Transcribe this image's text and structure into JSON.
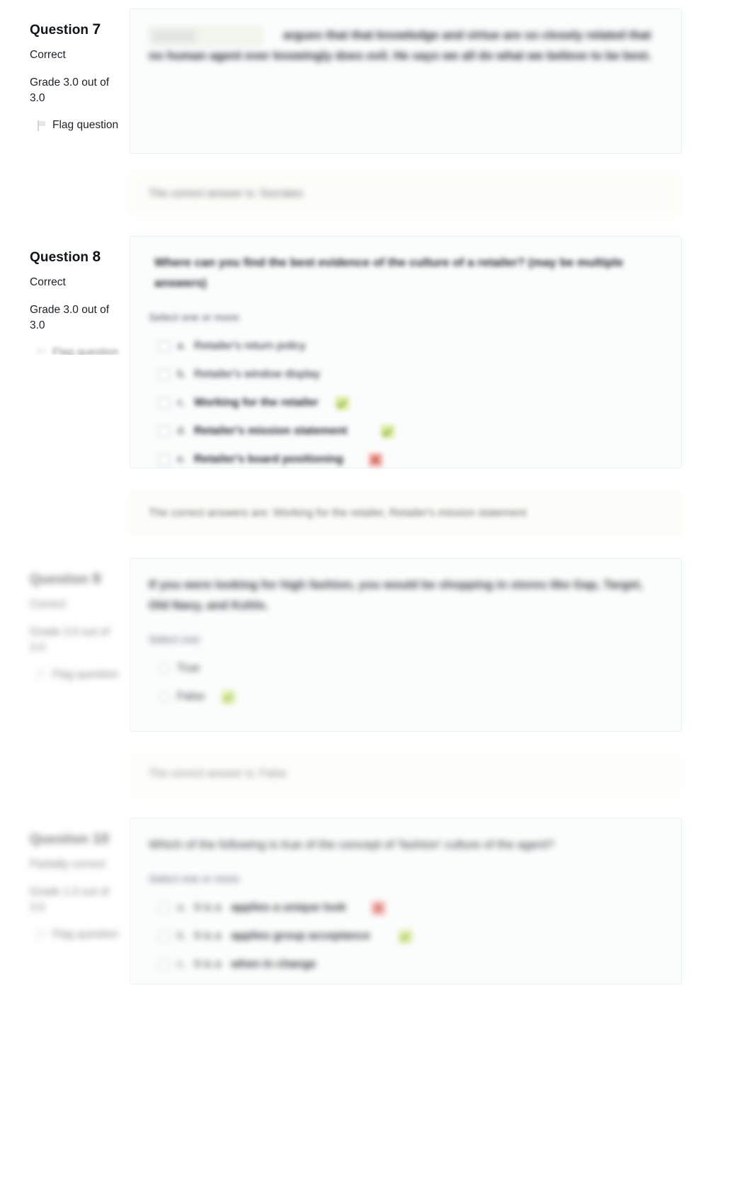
{
  "page": {
    "type": "quiz-review",
    "accent_correct": "#d9ec9a",
    "accent_wrong": "#f3a9a3",
    "panel_bg": "#fbfdfd",
    "feedback_bg": "#fcfdf6"
  },
  "questions": [
    {
      "id": "q7",
      "number_label": "Question",
      "number": "7",
      "state": "Correct",
      "grade": "Grade 3.0 out of 3.0",
      "flag_label": "Flag question",
      "type": "drag-and-drop-into-text",
      "text": "argues that that knowledge and virtue are so closely related that no human agent ever knowingly does evil. He says we all do what we believe to be best.",
      "dropzone_value": "Socrates",
      "options": [],
      "feedback_label": "The correct answer is:",
      "feedback_value": "Socrates"
    },
    {
      "id": "q8",
      "number_label": "Question",
      "number": "8",
      "state": "Correct",
      "grade": "Grade 3.0 out of 3.0",
      "flag_label": "Flag question",
      "type": "multiple-choice-multi",
      "text": "Where can you find the best evidence of the culture of a retailer? (may be multiple answers)",
      "prompt": "Select one or more:",
      "options": [
        {
          "letter": "a.",
          "text": "Retailer's return policy",
          "mark": ""
        },
        {
          "letter": "b.",
          "text": "Retailer's window display",
          "mark": ""
        },
        {
          "letter": "c.",
          "text": "Working for the retailer",
          "mark": "correct"
        },
        {
          "letter": "d.",
          "text": "Retailer's mission statement",
          "mark": "correct"
        },
        {
          "letter": "e.",
          "text": "Retailer's board positioning",
          "mark": "wrong"
        }
      ],
      "feedback_label": "The correct answers are:",
      "feedback_value": "Working for the retailer, Retailer's mission statement"
    },
    {
      "id": "q9",
      "number_label": "Question",
      "number": "9",
      "state": "Correct",
      "grade": "Grade 3.0 out of 3.0",
      "flag_label": "Flag question",
      "type": "true-false",
      "text": "If you were looking for high fashion, you would be shopping in stores like Gap, Target, Old Navy, and Kohls.",
      "prompt": "Select one:",
      "options": [
        {
          "letter": "",
          "text": "True",
          "mark": ""
        },
        {
          "letter": "",
          "text": "False",
          "mark": "correct"
        }
      ],
      "feedback_label": "The correct answer is:",
      "feedback_value": "False"
    },
    {
      "id": "q10",
      "number_label": "Question",
      "number": "10",
      "state": "Partially correct",
      "grade": "Grade 1.0 out of 3.0",
      "flag_label": "Flag question",
      "type": "multiple-choice-multi",
      "text": "Which of the following is true of the concept of 'fashion' culture of the agent?",
      "prompt": "Select one or more:",
      "options": [
        {
          "letter": "a.",
          "text": "It is a",
          "text_strong": "applies a unique look",
          "mark": "wrong"
        },
        {
          "letter": "b.",
          "text": "It is a",
          "text_strong": "applies group acceptance",
          "mark": "correct"
        },
        {
          "letter": "c.",
          "text": "It is a",
          "text_strong": "when in change",
          "mark": ""
        }
      ],
      "feedback_label": "",
      "feedback_value": ""
    }
  ]
}
